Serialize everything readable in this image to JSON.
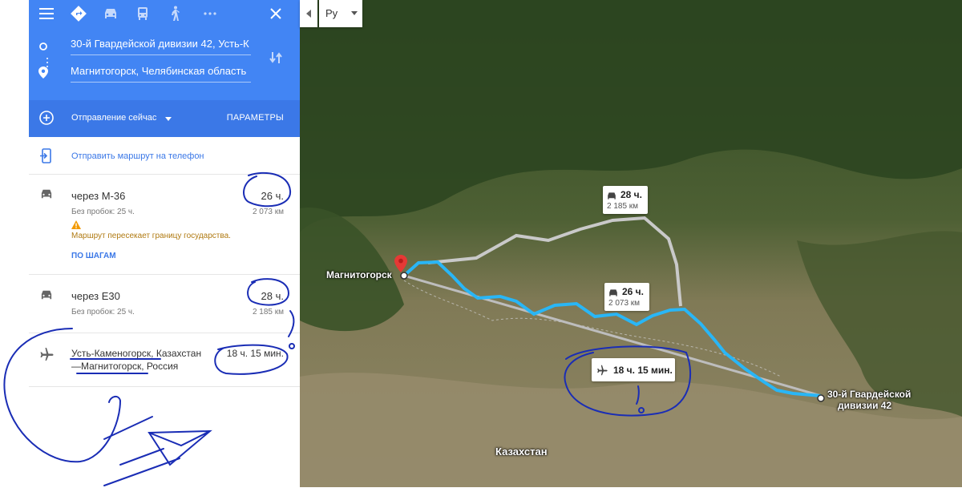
{
  "colors": {
    "accent_blue": "#4285f4",
    "depart_blue": "#3b78e7",
    "route_primary": "#29b6f6",
    "route_alt": "#bdbdbd",
    "pen_ink": "#1a2db5"
  },
  "toolbar": {
    "modes": [
      {
        "name": "menu-icon",
        "active": false
      },
      {
        "name": "directions-icon",
        "active": true
      },
      {
        "name": "car-icon",
        "active": false
      },
      {
        "name": "transit-icon",
        "active": false
      },
      {
        "name": "walk-icon",
        "active": false
      },
      {
        "name": "more-icon",
        "active": false
      },
      {
        "name": "close-icon",
        "active": false
      }
    ]
  },
  "inputs": {
    "origin": "30-й Гвардейской дивизии 42, Усть-К",
    "destination": "Магнитогорск, Челябинская область"
  },
  "depart": {
    "label": "Отправление сейчас",
    "params": "ПАРАМЕТРЫ"
  },
  "send": {
    "label": "Отправить маршрут на телефон"
  },
  "routes": [
    {
      "name": "через М-36",
      "time": "26 ч.",
      "sub": "Без пробок: 25 ч.",
      "distance": "2 073 км",
      "warning": "Маршрут пересекает границу государства.",
      "steps": "ПО ШАГАМ"
    },
    {
      "name": "через Е30",
      "time": "28 ч.",
      "sub": "Без пробок: 25 ч.",
      "distance": "2 185 км"
    }
  ],
  "flight": {
    "from": "Усть-Каменогорск",
    "from_country": ", Казахстан",
    "to_prefix": "—",
    "to": "Магнитогорск",
    "to_country": ", Россия",
    "time": "18 ч. 15 мин."
  },
  "map": {
    "language": "Ру",
    "labels": {
      "magnitogorsk": "Магнитогорск",
      "origin_line1": "30-й Гвардейской",
      "origin_line2": "дивизии 42",
      "kazakhstan": "Казахстан"
    },
    "callouts": {
      "alt_time": "28 ч.",
      "alt_distance": "2 185 км",
      "main_time": "26 ч.",
      "main_distance": "2 073 км",
      "flight_time": "18 ч. 15 мин."
    }
  }
}
